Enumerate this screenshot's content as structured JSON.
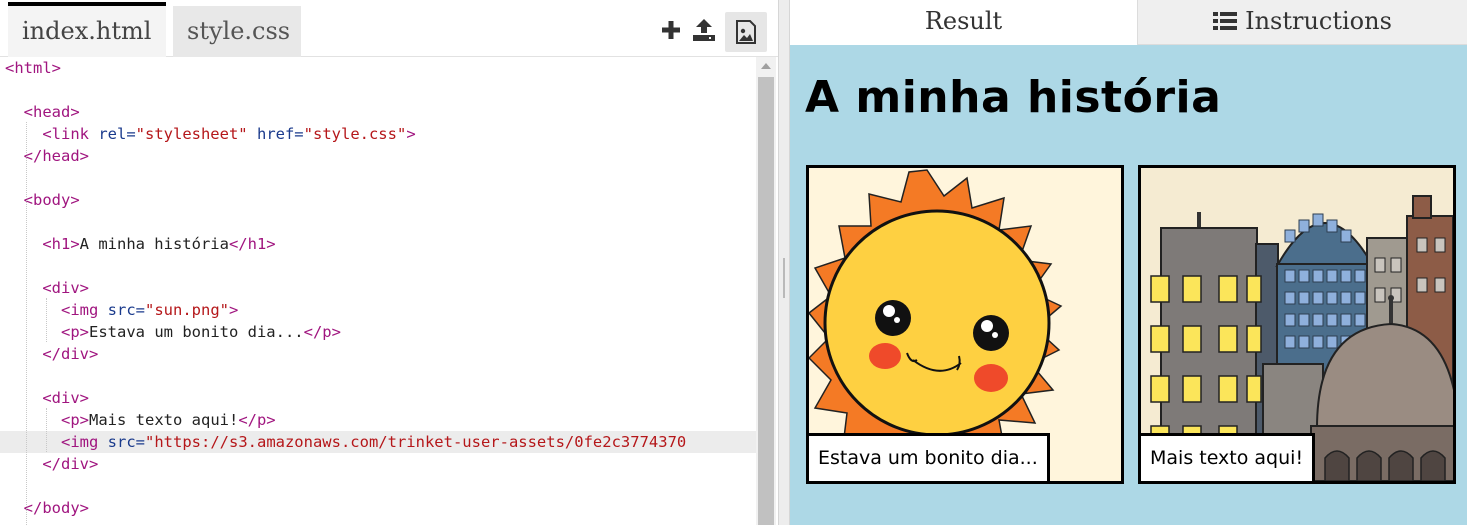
{
  "editor": {
    "tabs": [
      {
        "label": "index.html",
        "active": true
      },
      {
        "label": "style.css",
        "active": false
      }
    ],
    "toolbar": {
      "add_icon": "plus-icon",
      "upload_icon": "upload-icon",
      "image_icon": "image-icon"
    },
    "lines": [
      [
        {
          "t": "tag",
          "v": "<html>"
        }
      ],
      [],
      [
        {
          "t": "txt",
          "v": "  "
        },
        {
          "t": "tag",
          "v": "<head>"
        }
      ],
      [
        {
          "t": "txt",
          "v": "    "
        },
        {
          "t": "tag",
          "v": "<link "
        },
        {
          "t": "attr",
          "v": "rel="
        },
        {
          "t": "str",
          "v": "\"stylesheet\""
        },
        {
          "t": "txt",
          "v": " "
        },
        {
          "t": "attr",
          "v": "href="
        },
        {
          "t": "str",
          "v": "\"style.css\""
        },
        {
          "t": "tag",
          "v": ">"
        }
      ],
      [
        {
          "t": "txt",
          "v": "  "
        },
        {
          "t": "tag",
          "v": "</head>"
        }
      ],
      [],
      [
        {
          "t": "txt",
          "v": "  "
        },
        {
          "t": "tag",
          "v": "<body>"
        }
      ],
      [],
      [
        {
          "t": "txt",
          "v": "    "
        },
        {
          "t": "tag",
          "v": "<h1>"
        },
        {
          "t": "txt",
          "v": "A minha história"
        },
        {
          "t": "tag",
          "v": "</h1>"
        }
      ],
      [],
      [
        {
          "t": "txt",
          "v": "    "
        },
        {
          "t": "tag",
          "v": "<div>"
        }
      ],
      [
        {
          "t": "txt",
          "v": "      "
        },
        {
          "t": "tag",
          "v": "<img "
        },
        {
          "t": "attr",
          "v": "src="
        },
        {
          "t": "str",
          "v": "\"sun.png\""
        },
        {
          "t": "tag",
          "v": ">"
        }
      ],
      [
        {
          "t": "txt",
          "v": "      "
        },
        {
          "t": "tag",
          "v": "<p>"
        },
        {
          "t": "txt",
          "v": "Estava um bonito dia..."
        },
        {
          "t": "tag",
          "v": "</p>"
        }
      ],
      [
        {
          "t": "txt",
          "v": "    "
        },
        {
          "t": "tag",
          "v": "</div>"
        }
      ],
      [],
      [
        {
          "t": "txt",
          "v": "    "
        },
        {
          "t": "tag",
          "v": "<div>"
        }
      ],
      [
        {
          "t": "txt",
          "v": "      "
        },
        {
          "t": "tag",
          "v": "<p>"
        },
        {
          "t": "txt",
          "v": "Mais texto aqui!"
        },
        {
          "t": "tag",
          "v": "</p>"
        }
      ],
      [
        {
          "t": "txt",
          "v": "      "
        },
        {
          "t": "tag",
          "v": "<img "
        },
        {
          "t": "attr",
          "v": "src="
        },
        {
          "t": "str",
          "v": "\"https://s3.amazonaws.com/trinket-user-assets/0fe2c3774370"
        }
      ],
      [
        {
          "t": "txt",
          "v": "    "
        },
        {
          "t": "tag",
          "v": "</div>"
        }
      ],
      [],
      [
        {
          "t": "txt",
          "v": "  "
        },
        {
          "t": "tag",
          "v": "</body>"
        }
      ]
    ]
  },
  "result_tabs": {
    "result": "Result",
    "instructions": "Instructions",
    "instructions_icon": "list-icon"
  },
  "preview": {
    "title": "A minha história",
    "panels": [
      {
        "caption": "Estava um bonito dia...",
        "image": "sun-illustration"
      },
      {
        "caption": "Mais texto aqui!",
        "image": "city-illustration"
      }
    ]
  },
  "colors": {
    "preview_bg": "#add8e6",
    "tag": "#a0157f",
    "attr": "#1a3a8c",
    "string": "#b5171a"
  }
}
